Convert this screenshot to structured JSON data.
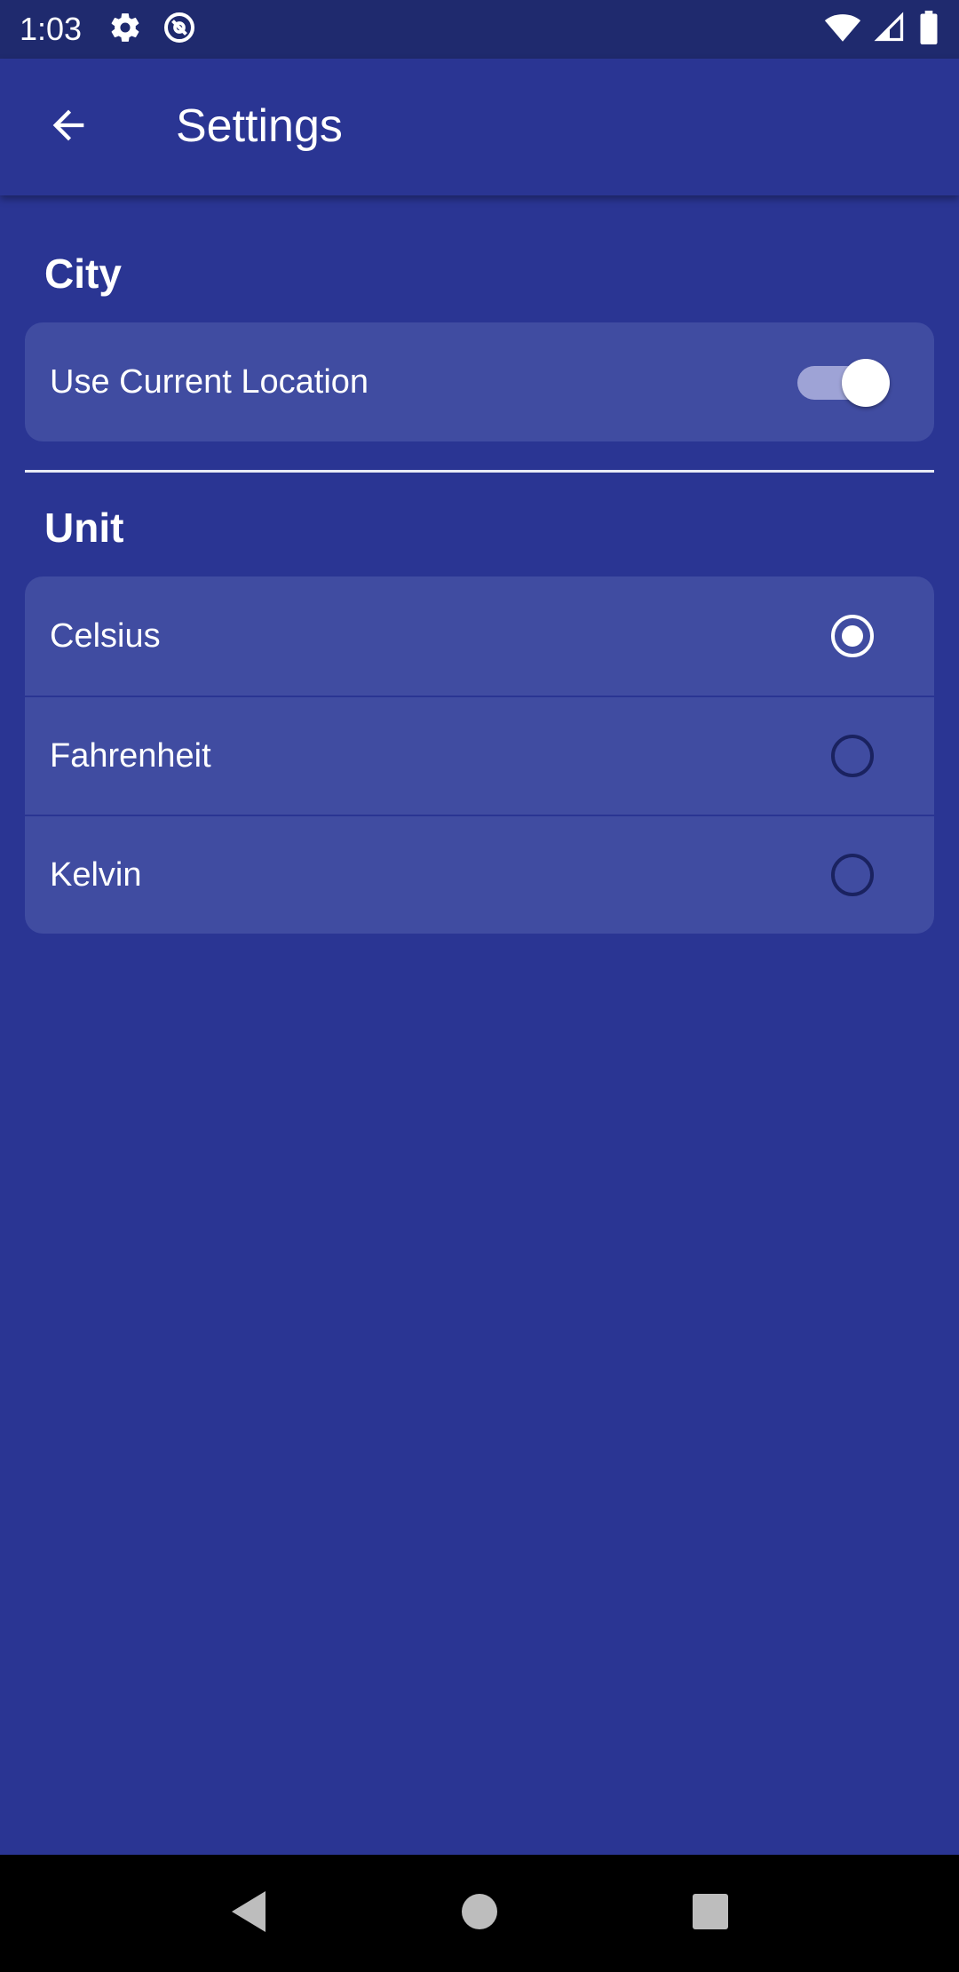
{
  "status_bar": {
    "time": "1:03",
    "left_icons": [
      "settings-gear-icon",
      "no-entry-icon"
    ],
    "right_icons": [
      "wifi-icon",
      "cellular-signal-icon",
      "battery-icon"
    ]
  },
  "app_bar": {
    "back_icon": "arrow-back-icon",
    "title": "Settings"
  },
  "sections": {
    "city": {
      "header": "City",
      "use_current_location": {
        "label": "Use Current Location",
        "enabled": true
      }
    },
    "unit": {
      "header": "Unit",
      "options": [
        {
          "label": "Celsius",
          "selected": true
        },
        {
          "label": "Fahrenheit",
          "selected": false
        },
        {
          "label": "Kelvin",
          "selected": false
        }
      ]
    }
  },
  "colors": {
    "background": "#2a3593",
    "status_bar": "#1f2a6e",
    "card": "#404ca1",
    "switch_track": "#9ea3d6",
    "radio_unselected": "#1a2260",
    "nav_bar": "#000000"
  },
  "nav_bar": {
    "buttons": [
      "back-triangle-icon",
      "home-circle-icon",
      "recents-square-icon"
    ]
  }
}
